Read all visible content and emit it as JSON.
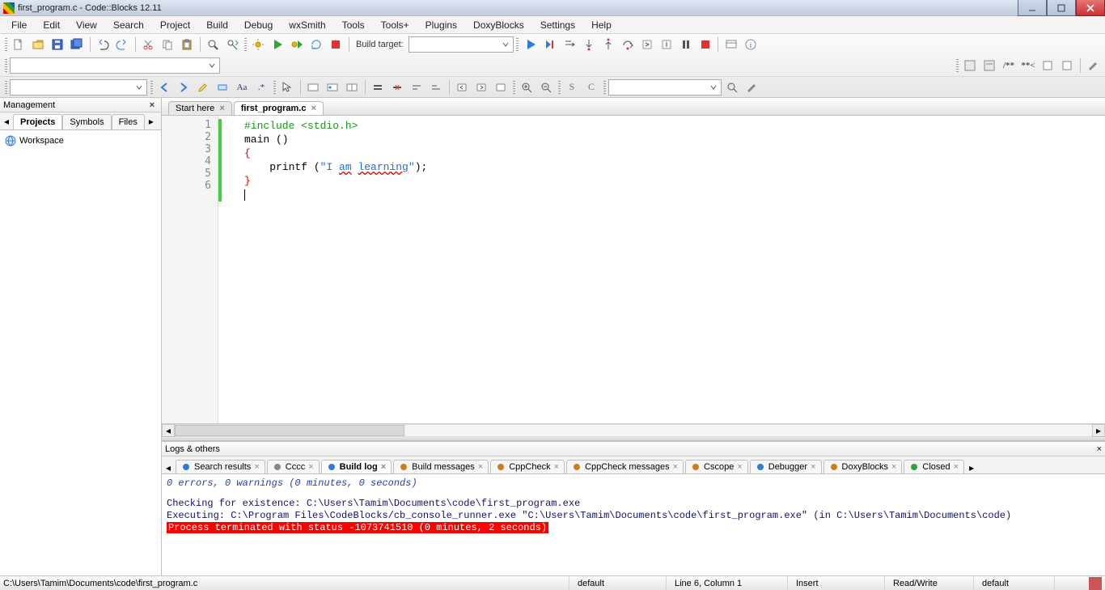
{
  "window": {
    "title": "first_program.c - Code::Blocks 12.11"
  },
  "menu": {
    "items": [
      "File",
      "Edit",
      "View",
      "Search",
      "Project",
      "Build",
      "Debug",
      "wxSmith",
      "Tools",
      "Tools+",
      "Plugins",
      "DoxyBlocks",
      "Settings",
      "Help"
    ]
  },
  "toolbars": {
    "build_target_label": "Build target:",
    "build_target_value": ""
  },
  "management": {
    "title": "Management",
    "tabs": [
      "Projects",
      "Symbols",
      "Files"
    ],
    "active_tab": 0,
    "workspace_label": "Workspace"
  },
  "editor_tabs": {
    "items": [
      "Start here",
      "first_program.c"
    ],
    "active": 1
  },
  "code": {
    "lines": [
      {
        "n": 1,
        "segments": [
          {
            "cls": "tok-pre",
            "text": "#include <stdio.h>"
          }
        ]
      },
      {
        "n": 2,
        "segments": [
          {
            "cls": "tok-kw",
            "text": "main ()"
          }
        ]
      },
      {
        "n": 3,
        "segments": [
          {
            "cls": "tok-brace",
            "text": "{"
          }
        ]
      },
      {
        "n": 4,
        "segments": [
          {
            "cls": "tok-kw",
            "text": "    printf ("
          },
          {
            "cls": "tok-str",
            "text": "\"I "
          },
          {
            "cls": "tok-str sp-err",
            "text": "am"
          },
          {
            "cls": "tok-str",
            "text": " "
          },
          {
            "cls": "tok-str sp-err",
            "text": "learning"
          },
          {
            "cls": "tok-str",
            "text": "\""
          },
          {
            "cls": "tok-kw",
            "text": ");"
          }
        ]
      },
      {
        "n": 5,
        "segments": [
          {
            "cls": "tok-brace",
            "text": "}"
          }
        ]
      },
      {
        "n": 6,
        "segments": [],
        "cursor": true
      }
    ]
  },
  "logs": {
    "title": "Logs & others",
    "tabs": [
      "Search results",
      "Cccc",
      "Build log",
      "Build messages",
      "CppCheck",
      "CppCheck messages",
      "Cscope",
      "Debugger",
      "DoxyBlocks",
      "Closed"
    ],
    "active_tab": 2,
    "body": {
      "summary": "0 errors, 0 warnings (0 minutes, 0 seconds)",
      "line_check": "Checking for existence: C:\\Users\\Tamim\\Documents\\code\\first_program.exe",
      "line_exec": "Executing: C:\\Program Files\\CodeBlocks/cb_console_runner.exe \"C:\\Users\\Tamim\\Documents\\code\\first_program.exe\"  (in C:\\Users\\Tamim\\Documents\\code)",
      "line_term": "Process terminated with status -1073741510 (0 minutes, 2 seconds)"
    }
  },
  "status": {
    "path": "C:\\Users\\Tamim\\Documents\\code\\first_program.c",
    "enc": "default",
    "pos": "Line 6, Column 1",
    "mode": "Insert",
    "rw": "Read/Write",
    "eol": "default"
  }
}
